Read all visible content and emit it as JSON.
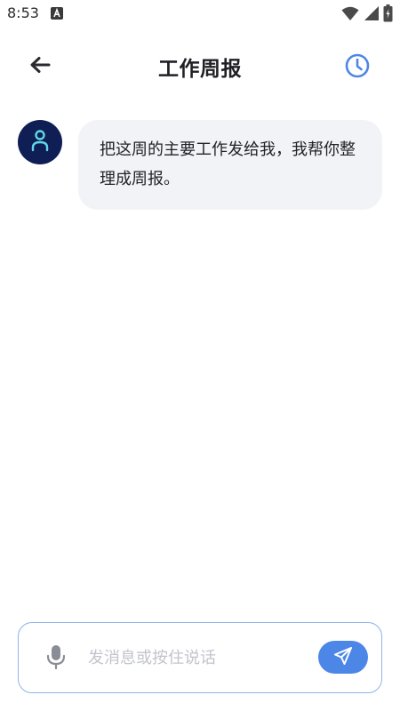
{
  "status_bar": {
    "time": "8:53",
    "icons": [
      "a-notification-icon",
      "wifi-icon",
      "cellular-signal-icon",
      "battery-icon"
    ]
  },
  "header": {
    "title": "工作周报",
    "back_icon": "arrow-left-icon",
    "history_icon": "clock-icon"
  },
  "chat": {
    "messages": [
      {
        "sender": "assistant",
        "avatar_icon": "person-icon",
        "text": "把这周的主要工作发给我，我帮你整理成周报。"
      }
    ]
  },
  "composer": {
    "mic_icon": "microphone-icon",
    "placeholder": "发消息或按住说话",
    "value": "",
    "send_icon": "paper-plane-icon"
  },
  "colors": {
    "accent": "#4c86e6",
    "avatar_bg": "#0f1f56",
    "avatar_icon": "#5fd7e8",
    "bubble_bg": "#f2f3f6",
    "input_border": "#8db3ea"
  }
}
